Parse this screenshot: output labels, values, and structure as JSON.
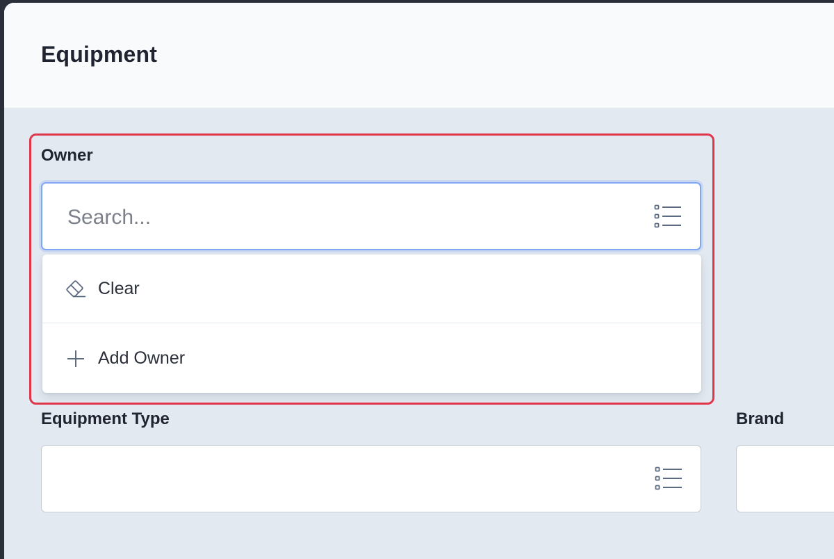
{
  "header": {
    "title": "Equipment"
  },
  "owner": {
    "label": "Owner",
    "placeholder": "Search...",
    "list_icon": "list-icon",
    "dropdown": {
      "items": [
        {
          "label": "Clear",
          "icon": "eraser-icon"
        },
        {
          "label": "Add Owner",
          "icon": "plus-icon"
        }
      ]
    }
  },
  "equipment_type": {
    "label": "Equipment Type",
    "value": "",
    "list_icon": "list-icon"
  },
  "brand": {
    "label": "Brand",
    "value": ""
  },
  "colors": {
    "highlight": "#e0364b",
    "focus_border": "#7ea6f2",
    "background": "#e3e9f1",
    "header_bg": "#f8fafc"
  }
}
